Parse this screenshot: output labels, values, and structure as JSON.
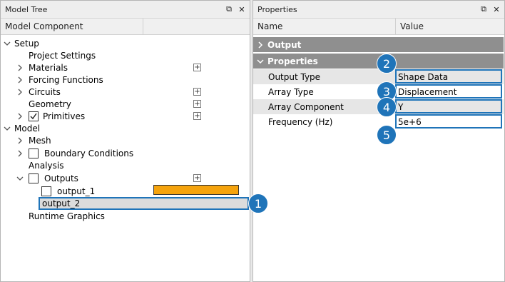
{
  "model_tree": {
    "title": "Model Tree",
    "column_header": "Model Component",
    "items": [
      {
        "label": "Setup"
      },
      {
        "label": "Project Settings"
      },
      {
        "label": "Materials"
      },
      {
        "label": "Forcing Functions"
      },
      {
        "label": "Circuits"
      },
      {
        "label": "Geometry"
      },
      {
        "label": "Primitives"
      },
      {
        "label": "Model"
      },
      {
        "label": "Mesh"
      },
      {
        "label": "Boundary Conditions"
      },
      {
        "label": "Analysis"
      },
      {
        "label": "Outputs"
      },
      {
        "label": "output_1"
      },
      {
        "label": "output_2"
      },
      {
        "label": "Runtime Graphics"
      }
    ],
    "plus_label": "+",
    "output_1_color": "#f5a30d"
  },
  "properties": {
    "title": "Properties",
    "col_name": "Name",
    "col_value": "Value",
    "groups": [
      {
        "label": "Output"
      },
      {
        "label": "Properties"
      }
    ],
    "rows": [
      {
        "name": "Output Type",
        "value": "Shape Data"
      },
      {
        "name": "Array Type",
        "value": "Displacement"
      },
      {
        "name": "Array Component",
        "value": "Y"
      },
      {
        "name": "Frequency (Hz)",
        "value": "5e+6"
      }
    ]
  },
  "callouts": [
    "1",
    "2",
    "3",
    "4",
    "5"
  ],
  "accent_color": "#1f74b9"
}
